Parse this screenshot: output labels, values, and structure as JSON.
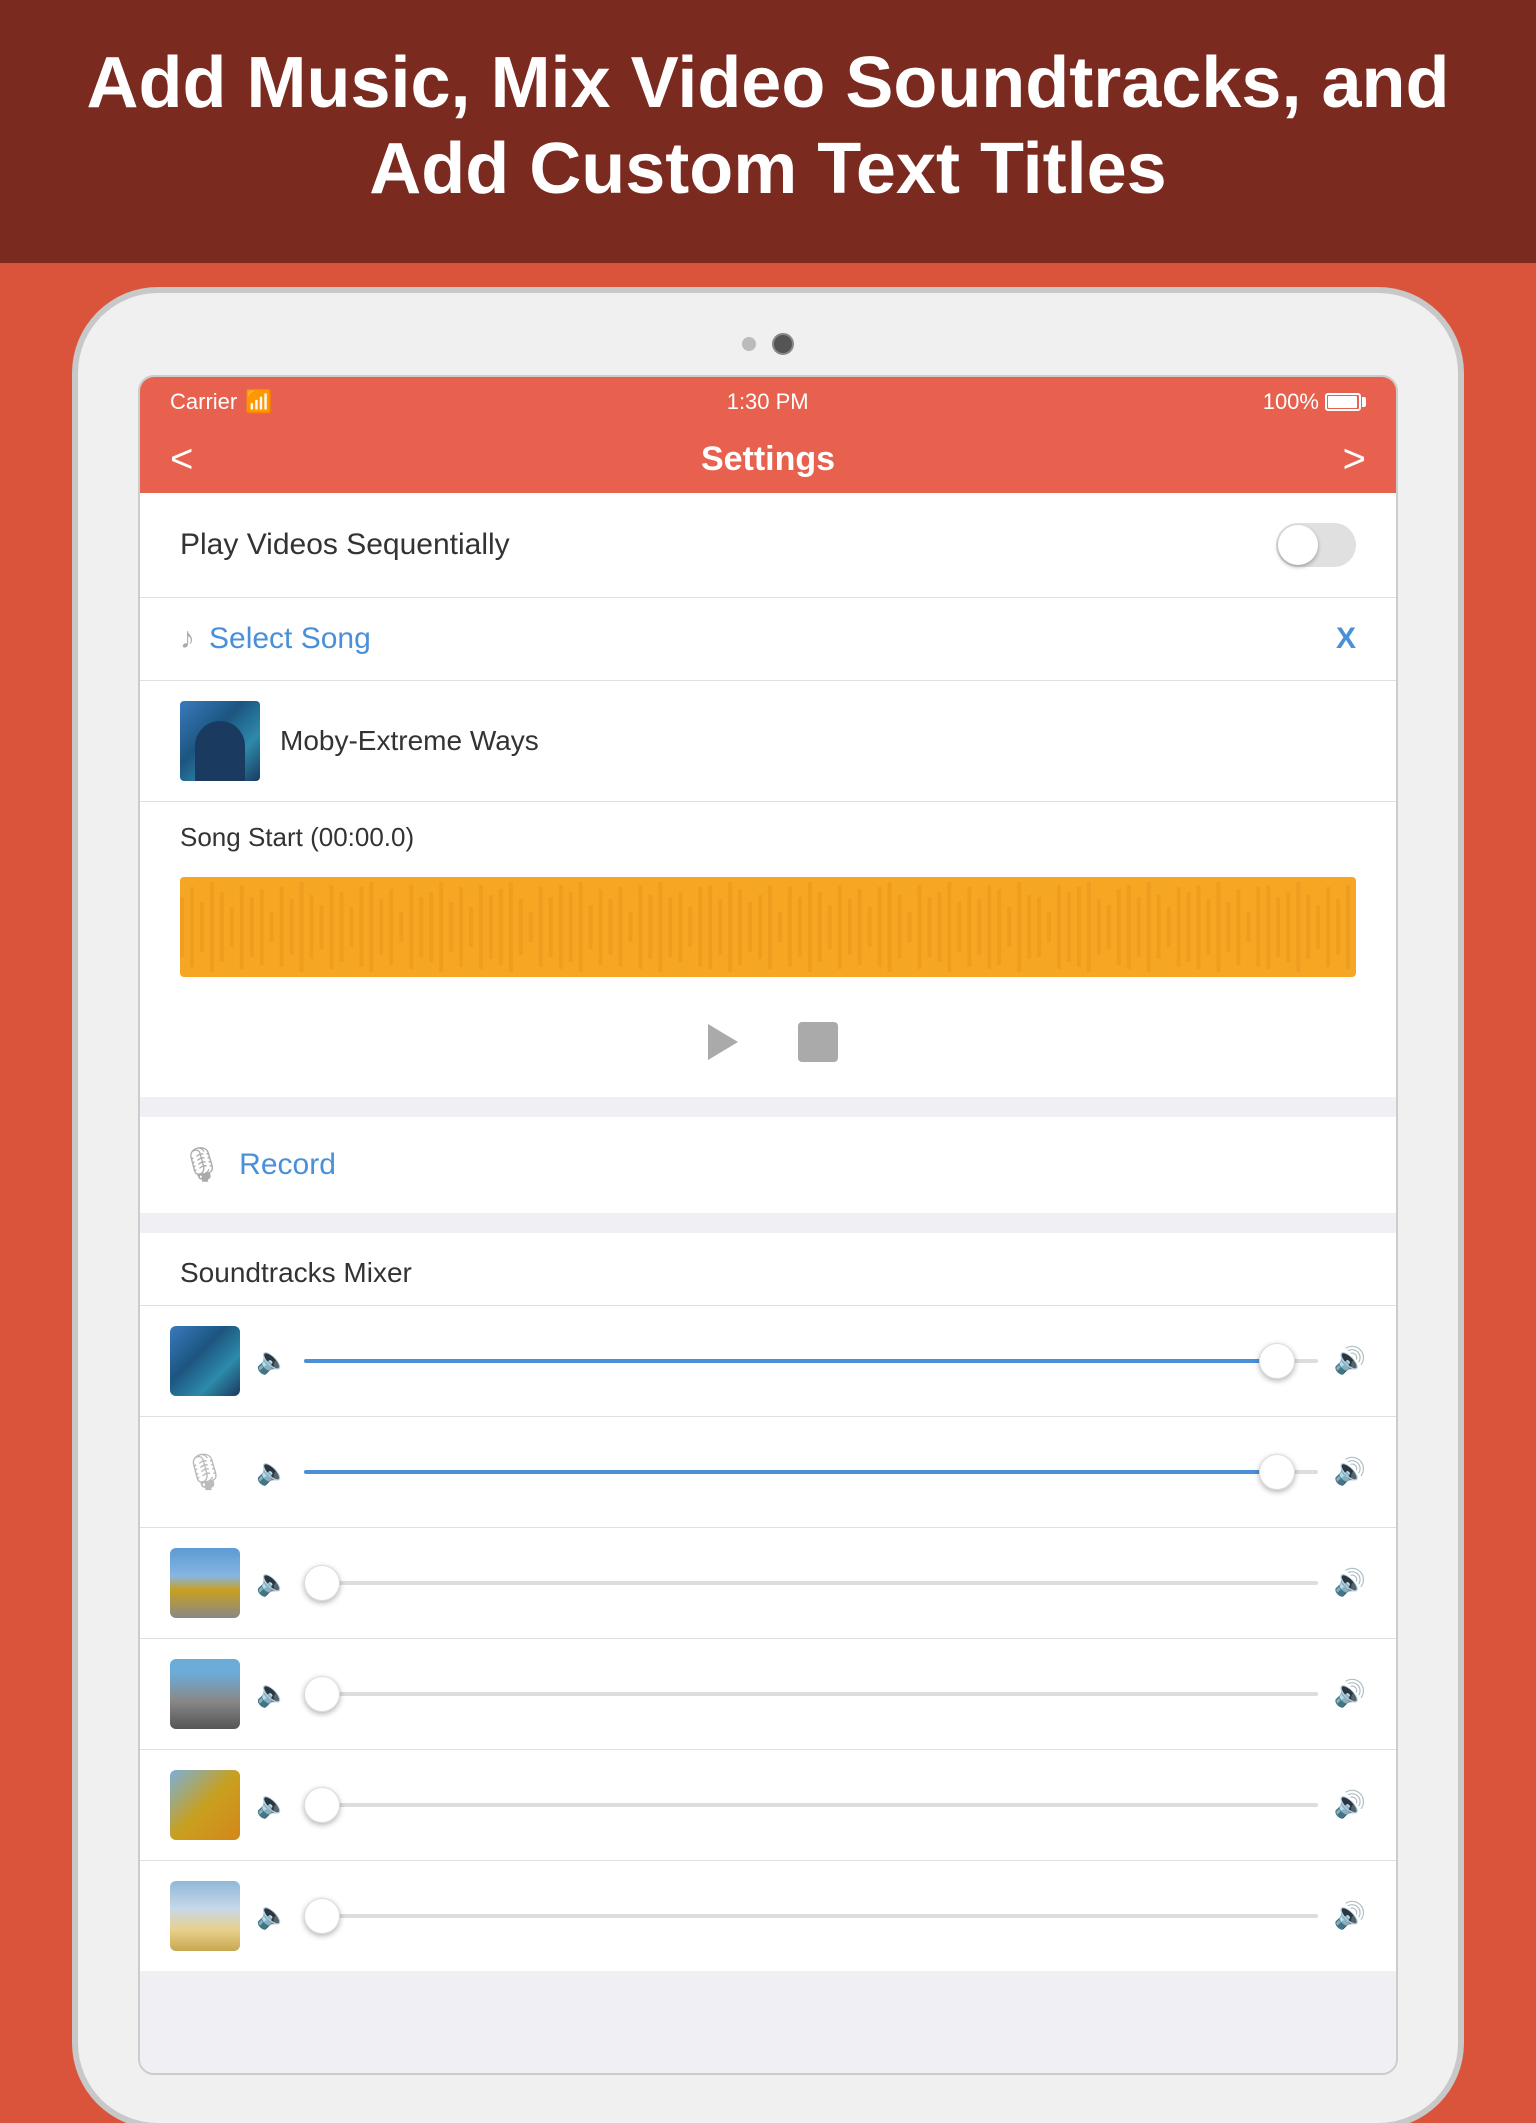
{
  "header": {
    "title": "Add Music, Mix Video Soundtracks,\nand Add Custom Text Titles",
    "background_color": "#7b2a20"
  },
  "status_bar": {
    "carrier": "Carrier",
    "time": "1:30 PM",
    "battery": "100%"
  },
  "nav_bar": {
    "title": "Settings",
    "back_label": "<",
    "forward_label": ">"
  },
  "settings": {
    "play_videos_sequentially": {
      "label": "Play Videos Sequentially",
      "enabled": false
    }
  },
  "select_song": {
    "label": "Select Song",
    "close_label": "X",
    "song_name": "Moby-Extreme Ways",
    "song_start_label": "Song Start (00:00.0)"
  },
  "playback": {
    "play_label": "▷",
    "stop_label": ""
  },
  "record": {
    "label": "Record"
  },
  "mixer": {
    "title": "Soundtracks Mixer",
    "rows": [
      {
        "type": "thumbnail",
        "thumb_class": "thumb-person",
        "fill_pct": 96
      },
      {
        "type": "mic",
        "fill_pct": 96
      },
      {
        "type": "thumbnail",
        "thumb_class": "thumb-bridge",
        "fill_pct": 0
      },
      {
        "type": "thumbnail",
        "thumb_class": "thumb-city",
        "fill_pct": 0
      },
      {
        "type": "thumbnail",
        "thumb_class": "thumb-bridge2",
        "fill_pct": 0
      },
      {
        "type": "thumbnail",
        "thumb_class": "thumb-building",
        "fill_pct": 0
      }
    ]
  },
  "colors": {
    "accent": "#e8614e",
    "blue": "#4a90d9",
    "waveform": "#f5a623"
  }
}
